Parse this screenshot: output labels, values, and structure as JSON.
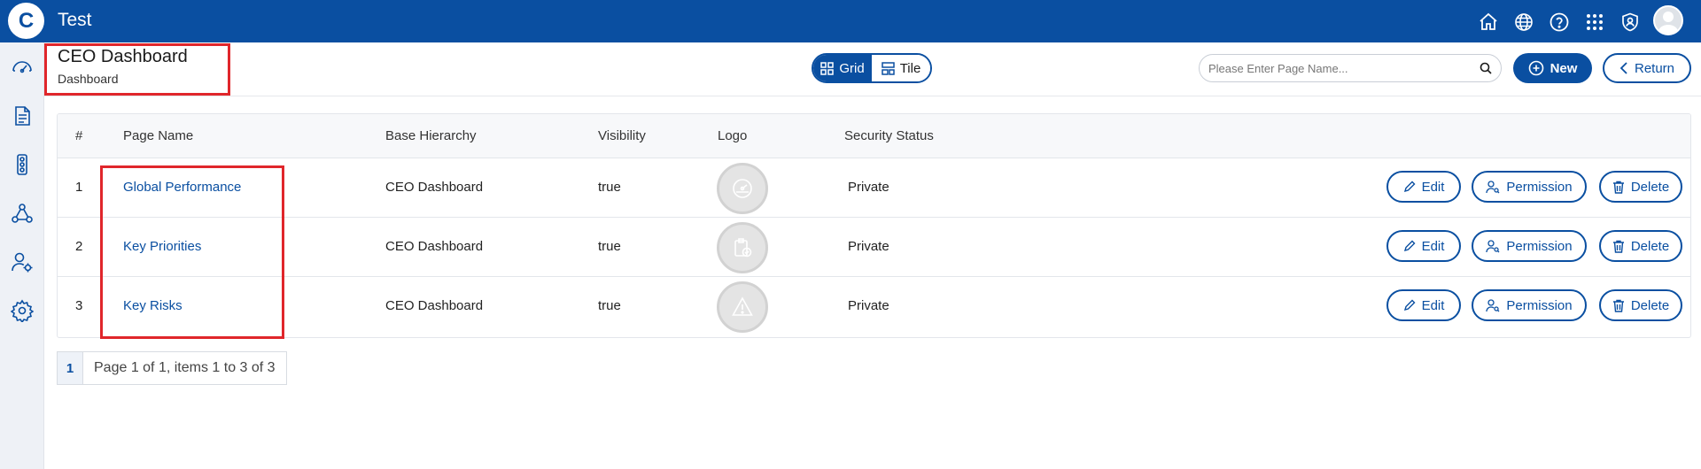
{
  "app": {
    "logo_letter": "C",
    "title": "Test"
  },
  "topbar": {
    "icons": [
      "home-icon",
      "globe-icon",
      "help-icon",
      "apps-grid-icon",
      "shield-user-icon",
      "user-avatar-icon"
    ]
  },
  "sidebar": {
    "icons": [
      "dashboard-gauge-icon",
      "document-icon",
      "traffic-light-icon",
      "triangle-people-icon",
      "user-settings-icon",
      "settings-gear-icon"
    ]
  },
  "header": {
    "title": "CEO Dashboard",
    "subtitle": "Dashboard",
    "view_grid": "Grid",
    "view_tile": "Tile",
    "search_placeholder": "Please Enter Page Name...",
    "new_label": "New",
    "return_label": "Return"
  },
  "table": {
    "columns": [
      "#",
      "Page Name",
      "Base Hierarchy",
      "Visibility",
      "Logo",
      "Security Status"
    ],
    "rows": [
      {
        "num": "1",
        "name": "Global Performance",
        "hierarchy": "CEO Dashboard",
        "visibility": "true",
        "logo": "gauge-logo-icon",
        "security": "Private"
      },
      {
        "num": "2",
        "name": "Key Priorities",
        "hierarchy": "CEO Dashboard",
        "visibility": "true",
        "logo": "clipboard-check-logo-icon",
        "security": "Private"
      },
      {
        "num": "3",
        "name": "Key Risks",
        "hierarchy": "CEO Dashboard",
        "visibility": "true",
        "logo": "warning-triangle-logo-icon",
        "security": "Private"
      }
    ],
    "actions": {
      "edit": "Edit",
      "permission": "Permission",
      "delete": "Delete"
    }
  },
  "pagination": {
    "current": "1",
    "info": "Page 1 of 1, items 1 to 3 of 3"
  },
  "colors": {
    "primary": "#0a4fa1",
    "highlight": "#e0262b"
  }
}
